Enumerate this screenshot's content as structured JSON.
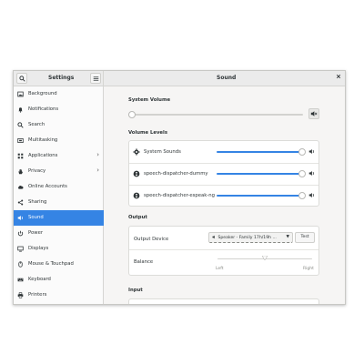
{
  "window": {
    "sidebar_title": "Settings",
    "main_title": "Sound"
  },
  "sidebar": {
    "items": [
      {
        "label": "Background"
      },
      {
        "label": "Notifications"
      },
      {
        "label": "Search"
      },
      {
        "label": "Multitasking"
      },
      {
        "label": "Applications",
        "chevron": "›"
      },
      {
        "label": "Privacy",
        "chevron": "›"
      },
      {
        "label": "Online Accounts"
      },
      {
        "label": "Sharing"
      },
      {
        "label": "Sound"
      },
      {
        "label": "Power"
      },
      {
        "label": "Displays"
      },
      {
        "label": "Mouse & Touchpad"
      },
      {
        "label": "Keyboard"
      },
      {
        "label": "Printers"
      }
    ]
  },
  "system_volume": {
    "heading": "System Volume",
    "level": 0.0
  },
  "volume_levels": {
    "heading": "Volume Levels",
    "apps": [
      {
        "name": "System Sounds",
        "level": 1.0
      },
      {
        "name": "speech-dispatcher-dummy",
        "level": 1.0
      },
      {
        "name": "speech-dispatcher-espeak-ng",
        "level": 1.0
      }
    ]
  },
  "output": {
    "heading": "Output",
    "device_label": "Output Device",
    "device_value": "Speaker - Family 17h/19h ...",
    "test_label": "Test",
    "balance_label": "Balance",
    "balance_left": "Left",
    "balance_right": "Right",
    "balance": 0.5
  },
  "input": {
    "heading": "Input"
  },
  "colors": {
    "accent": "#3584e4",
    "sidebar_active_text": "#ffffff"
  }
}
